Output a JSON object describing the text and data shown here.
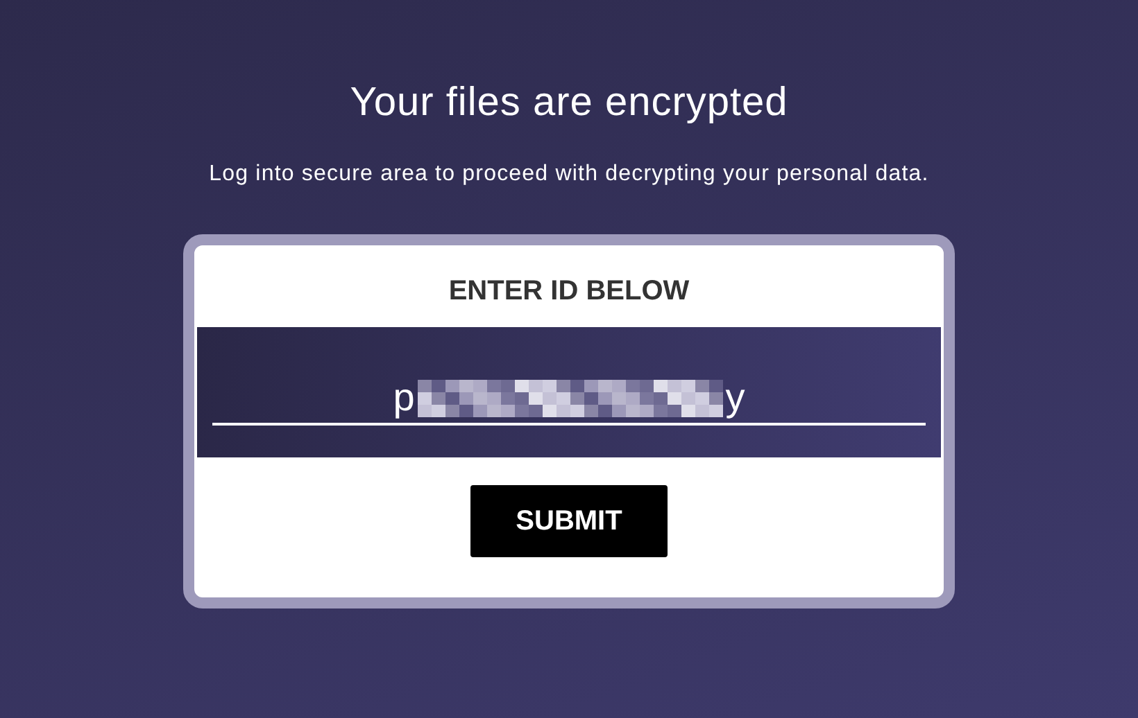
{
  "heading": "Your files are encrypted",
  "message": "Log into secure area to proceed with decrypting your personal data.",
  "login_card": {
    "label": "ENTER ID BELOW",
    "id_field": {
      "value_start": "p",
      "value_end": "y",
      "redacted": true
    },
    "submit_button": "SUBMIT"
  }
}
